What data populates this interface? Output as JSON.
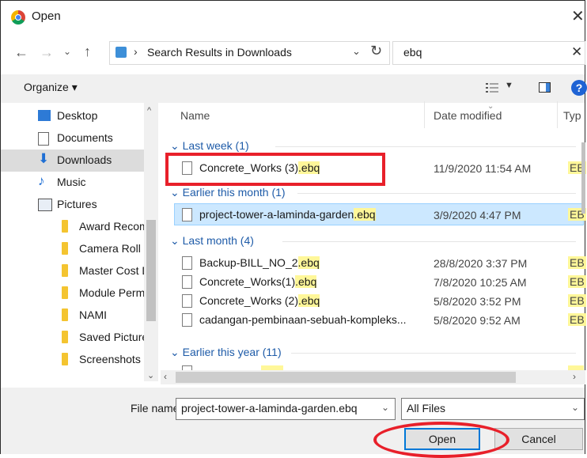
{
  "dialog": {
    "title": "Open",
    "close": "✕"
  },
  "address": {
    "separator": "›",
    "location": "Search Results in Downloads",
    "search": "ebq"
  },
  "toolbar": {
    "organize": "Organize ▾",
    "help": "?"
  },
  "sidebar": {
    "items": [
      {
        "label": "Desktop"
      },
      {
        "label": "Documents"
      },
      {
        "label": "Downloads"
      },
      {
        "label": "Music"
      },
      {
        "label": "Pictures"
      },
      {
        "label": "Award Recomm"
      },
      {
        "label": "Camera Roll"
      },
      {
        "label": "Master Cost Da"
      },
      {
        "label": "Module Permis"
      },
      {
        "label": "NAMI"
      },
      {
        "label": "Saved Pictures"
      },
      {
        "label": "Screenshots"
      }
    ]
  },
  "columns": {
    "name": "Name",
    "date": "Date modified",
    "type": "Typ"
  },
  "groups": [
    {
      "label": "Last week (1)"
    },
    {
      "label": "Earlier this month (1)"
    },
    {
      "label": "Last month (4)"
    },
    {
      "label": "Earlier this year (11)"
    }
  ],
  "files": [
    {
      "base": "Concrete_Works (3)",
      "ext": ".ebq",
      "date": "11/9/2020 11:54 AM",
      "type": "EB"
    },
    {
      "base": "project-tower-a-laminda-garden",
      "ext": ".ebq",
      "date": "3/9/2020 4:47 PM",
      "type": "EB"
    },
    {
      "base": "Backup-BILL_NO_2",
      "ext": ".ebq",
      "date": "28/8/2020 3:37 PM",
      "type": "EB"
    },
    {
      "base": "Concrete_Works(1)",
      "ext": ".ebq",
      "date": "7/8/2020 10:25 AM",
      "type": "EB"
    },
    {
      "base": "Concrete_Works (2)",
      "ext": ".ebq",
      "date": "5/8/2020 3:52 PM",
      "type": "EB"
    },
    {
      "base": "cadangan-pembinaan-sebuah-kompleks...",
      "ext": "",
      "date": "5/8/2020 9:52 AM",
      "type": "EB"
    }
  ],
  "footer": {
    "file_name_label": "File name:",
    "file_name_value": "project-tower-a-laminda-garden.ebq",
    "file_type": "All Files",
    "open": "Open",
    "cancel": "Cancel"
  }
}
